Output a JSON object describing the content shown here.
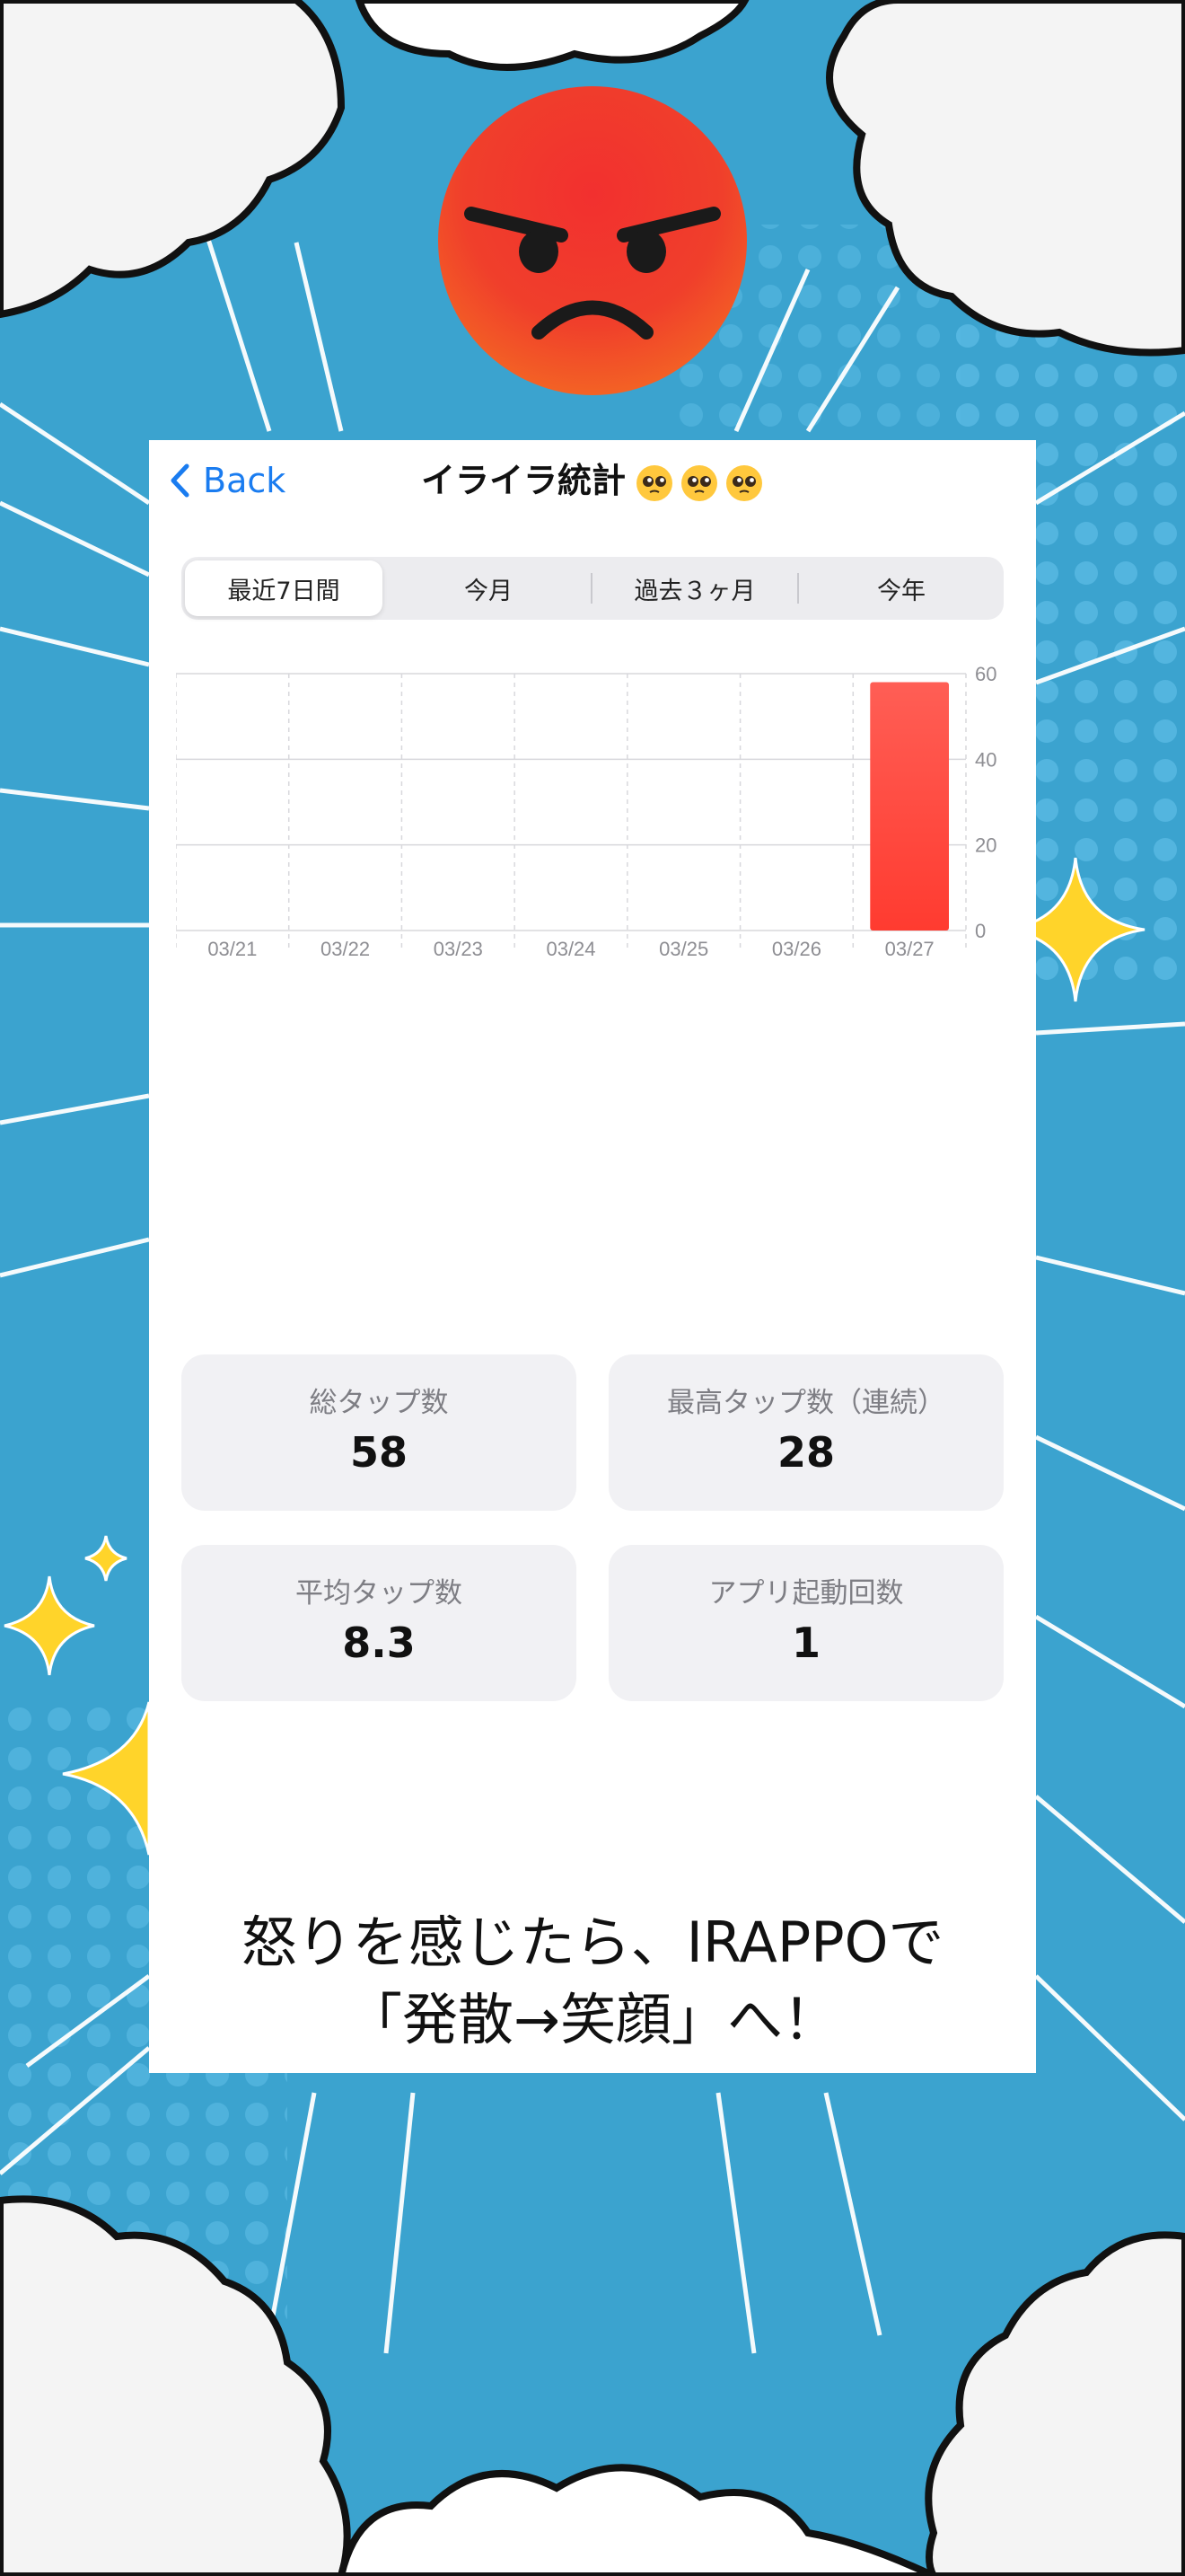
{
  "colors": {
    "background": "#3ba3cf",
    "accent_blue": "#1a7cf0",
    "bar_red": "#ff3b30",
    "card": "#ffffff",
    "stat_bg": "#f1f1f4"
  },
  "decor": {
    "top_face_icon": "angry-face-icon",
    "title_emoji_icon": "pleading-face-icon",
    "sparkle_icon": "sparkle-icon",
    "cloud_icon": "cloud-icon"
  },
  "nav": {
    "back_label": "Back",
    "title": "イライラ統計"
  },
  "segments": [
    {
      "label": "最近7日間",
      "active": true
    },
    {
      "label": "今月",
      "active": false
    },
    {
      "label": "過去３ヶ月",
      "active": false
    },
    {
      "label": "今年",
      "active": false
    }
  ],
  "chart_data": {
    "type": "bar",
    "categories": [
      "03/21",
      "03/22",
      "03/23",
      "03/24",
      "03/25",
      "03/26",
      "03/27"
    ],
    "values": [
      0,
      0,
      0,
      0,
      0,
      0,
      58
    ],
    "ylim": [
      0,
      60
    ],
    "yticks": [
      0,
      20,
      40,
      60
    ],
    "grid": true,
    "legend": "none",
    "xlabel": "",
    "ylabel": ""
  },
  "stats": [
    {
      "label": "総タップ数",
      "value": "58"
    },
    {
      "label": "最高タップ数（連続）",
      "value": "28"
    },
    {
      "label": "平均タップ数",
      "value": "8.3"
    },
    {
      "label": "アプリ起動回数",
      "value": "1"
    }
  ],
  "tagline": {
    "line1": "怒りを感じたら、IRAPPOで",
    "line2": "「発散→笑顔」へ！"
  }
}
